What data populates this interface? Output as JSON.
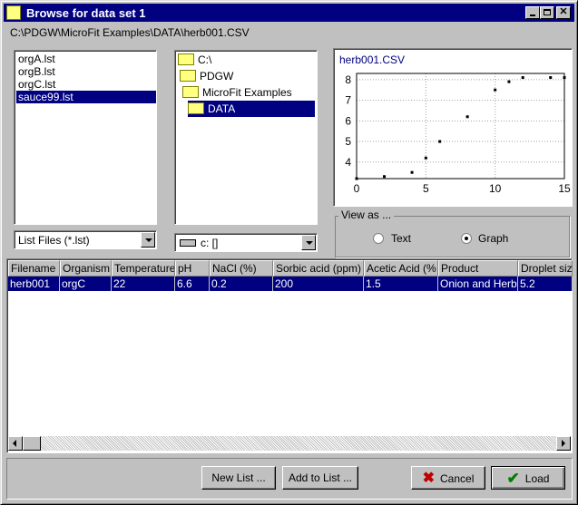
{
  "window": {
    "title": "Browse for data set 1"
  },
  "path": "C:\\PDGW\\MicroFit Examples\\DATA\\herb001.CSV",
  "file_list": {
    "items": [
      "orgA.lst",
      "orgB.lst",
      "orgC.lst",
      "sauce99.lst"
    ],
    "selected": 3
  },
  "file_type_combo": {
    "value": "List Files (*.lst)"
  },
  "folder_tree": {
    "items": [
      "C:\\",
      "PDGW",
      "MicroFit Examples",
      "DATA"
    ],
    "selected": 3
  },
  "drive_combo": {
    "value": "c: []"
  },
  "chart_data": {
    "type": "scatter",
    "title": "herb001.CSV",
    "x": [
      0,
      2,
      4,
      5,
      6,
      8,
      10,
      11,
      12,
      14,
      15
    ],
    "y": [
      3.2,
      3.3,
      3.5,
      4.2,
      5.0,
      6.2,
      7.5,
      7.9,
      8.1,
      8.1,
      8.1
    ],
    "xlim": [
      0,
      15
    ],
    "ylim": [
      3.2,
      8.3
    ],
    "x_ticks": [
      "0",
      "5",
      "10",
      "15"
    ],
    "y_ticks": [
      "4",
      "5",
      "6",
      "7",
      "8"
    ],
    "grid": true,
    "point_color": "#000000",
    "title_color": "#000080"
  },
  "view_as": {
    "label": "View as ...",
    "text_label": "Text",
    "graph_label": "Graph",
    "selected": "graph"
  },
  "table": {
    "headers": [
      "Filename",
      "Organism",
      "Temperature",
      "pH",
      "NaCl (%)",
      "Sorbic acid (ppm)",
      "Acetic Acid (%",
      "Product",
      "Droplet size"
    ],
    "rows": [
      [
        "herb001",
        "orgC",
        "22",
        "6.6",
        "0.2",
        "200",
        "1.5",
        "Onion and Herb",
        "5.2"
      ]
    ]
  },
  "buttons": {
    "new_list": "New List ...",
    "add_to_list": "Add to List ...",
    "cancel": "Cancel",
    "load": "Load"
  },
  "colors": {
    "selection": "#000080",
    "face": "#c0c0c0",
    "cancel_icon": "#c00000",
    "load_icon": "#008000"
  }
}
